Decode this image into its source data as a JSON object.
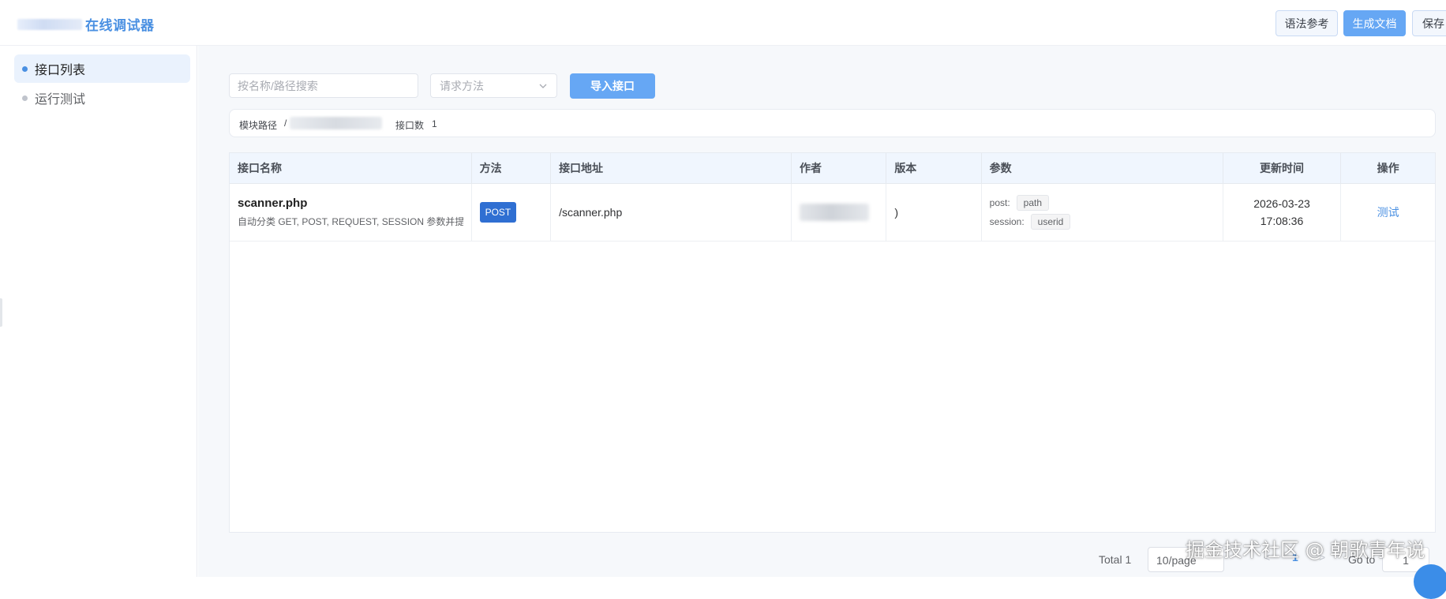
{
  "header": {
    "title": "在线调试器",
    "buttons": {
      "syntax": "语法参考",
      "generate_docs": "生成文档",
      "save": "保存"
    }
  },
  "sidebar": {
    "items": [
      {
        "label": "接口列表",
        "active": true
      },
      {
        "label": "运行测试",
        "active": false
      }
    ]
  },
  "toolbar": {
    "search_placeholder": "按名称/路径搜索",
    "method_placeholder": "请求方法",
    "import_label": "导入接口"
  },
  "module_bar": {
    "path_label": "模块路径",
    "path_value": "/",
    "count_label": "接口数",
    "count_value": "1"
  },
  "table": {
    "columns": [
      "接口名称",
      "方法",
      "接口地址",
      "作者",
      "版本",
      "参数",
      "更新时间",
      "操作"
    ],
    "rows": [
      {
        "name": "scanner.php",
        "description": "自动分类 GET, POST, REQUEST, SESSION 参数并提取",
        "method": "POST",
        "path": "/scanner.php",
        "version": ")",
        "params": [
          {
            "key": "post:",
            "value": "path"
          },
          {
            "key": "session:",
            "value": "userid"
          }
        ],
        "updated_date": "2026-03-23",
        "updated_time": "17:08:36",
        "action": "测试"
      }
    ]
  },
  "pagination": {
    "total": "Total 1",
    "page_size": "10/page",
    "prev": "<",
    "current_page": "1",
    "next": ">",
    "goto_label": "Go to",
    "goto_value": "1"
  },
  "watermark": "掘金技术社区 @ 朝歌青年说",
  "colors": {
    "accent": "#4a90e2",
    "primary_button": "#66a7f4",
    "method_tag": "#2f6fd2",
    "header_row": "#f0f6fe"
  }
}
